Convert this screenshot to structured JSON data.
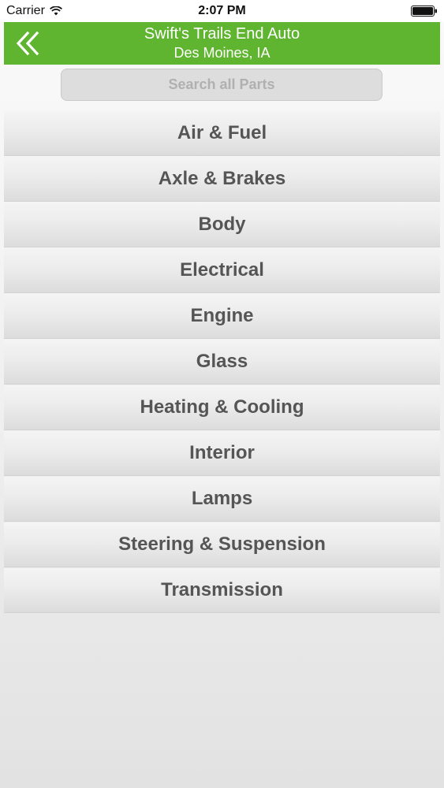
{
  "status_bar": {
    "carrier": "Carrier",
    "time": "2:07 PM"
  },
  "header": {
    "title": "Swift's Trails End Auto",
    "subtitle": "Des Moines, IA",
    "accent_color": "#5fb52f",
    "back_icon": "double-chevron-left-icon"
  },
  "search": {
    "placeholder": "Search all Parts",
    "value": ""
  },
  "categories": [
    {
      "label": "Air & Fuel"
    },
    {
      "label": "Axle & Brakes"
    },
    {
      "label": "Body"
    },
    {
      "label": "Electrical"
    },
    {
      "label": "Engine"
    },
    {
      "label": "Glass"
    },
    {
      "label": "Heating & Cooling"
    },
    {
      "label": "Interior"
    },
    {
      "label": "Lamps"
    },
    {
      "label": "Steering & Suspension"
    },
    {
      "label": "Transmission"
    }
  ]
}
